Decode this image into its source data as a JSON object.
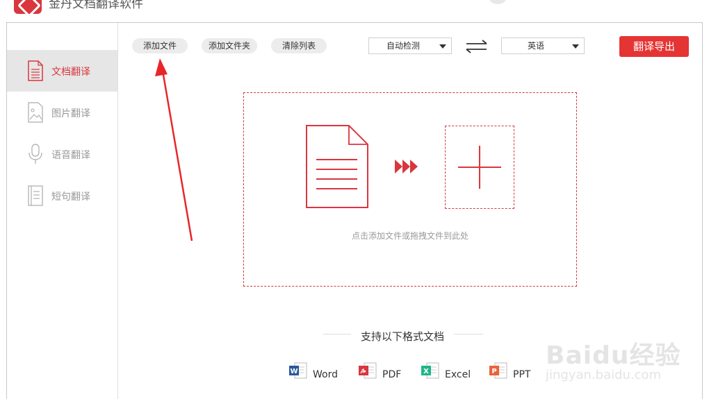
{
  "window": {
    "title": "金丹文档翻译软件"
  },
  "sidebar": {
    "items": [
      {
        "label": "文档翻译",
        "icon": "document-icon",
        "active": true
      },
      {
        "label": "图片翻译",
        "icon": "image-icon",
        "active": false
      },
      {
        "label": "语音翻译",
        "icon": "microphone-icon",
        "active": false
      },
      {
        "label": "短句翻译",
        "icon": "sentence-icon",
        "active": false
      }
    ]
  },
  "toolbar": {
    "add_file": "添加文件",
    "add_folder": "添加文件夹",
    "clear_list": "清除列表",
    "source_language": "自动检测",
    "target_language": "英语",
    "swap_icon": "swap-arrows-icon",
    "export": "翻译导出"
  },
  "drop_zone": {
    "hint": "点击添加文件或拖拽文件到此处"
  },
  "formats": {
    "title": "支持以下格式文档",
    "items": [
      {
        "label": "Word",
        "icon": "word-icon",
        "color": "#2b579a"
      },
      {
        "label": "PDF",
        "icon": "pdf-icon",
        "color": "#d9363e"
      },
      {
        "label": "Excel",
        "icon": "excel-icon",
        "color": "#1fb68a"
      },
      {
        "label": "PPT",
        "icon": "ppt-icon",
        "color": "#e8643a"
      }
    ]
  },
  "watermark": {
    "main": "Baidu经验",
    "sub": "jingyan.baidu.com"
  },
  "colors": {
    "accent": "#d9363e",
    "button_red": "#e53434",
    "sidebar_active_bg": "#e6e6e6"
  }
}
